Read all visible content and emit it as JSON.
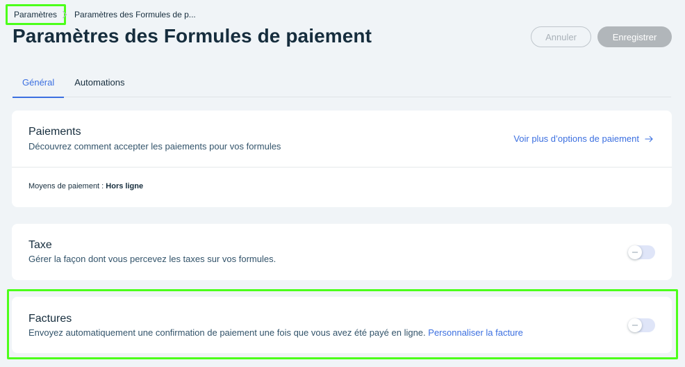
{
  "breadcrumb": {
    "parent": "Paramètres",
    "current": "Paramètres des Formules de p..."
  },
  "header": {
    "title": "Paramètres des Formules de paiement",
    "cancel_label": "Annuler",
    "save_label": "Enregistrer"
  },
  "tabs": [
    {
      "label": "Général",
      "active": true
    },
    {
      "label": "Automations",
      "active": false
    }
  ],
  "payments": {
    "title": "Paiements",
    "description": "Découvrez comment accepter les paiements pour vos formules",
    "link_label": "Voir plus d’options de paiement",
    "methods_label": "Moyens de paiement :",
    "methods_value": "Hors ligne"
  },
  "tax": {
    "title": "Taxe",
    "description": "Gérer la façon dont vous percevez les taxes sur vos formules.",
    "enabled": false
  },
  "invoices": {
    "title": "Factures",
    "description": "Envoyez automatiquement une confirmation de paiement une fois que vous avez été payé en ligne.",
    "link_label": "Personnaliser la facture",
    "enabled": false
  },
  "colors": {
    "accent": "#3b6fe0",
    "background": "#f0f4f7",
    "highlight": "#4cff1a"
  }
}
